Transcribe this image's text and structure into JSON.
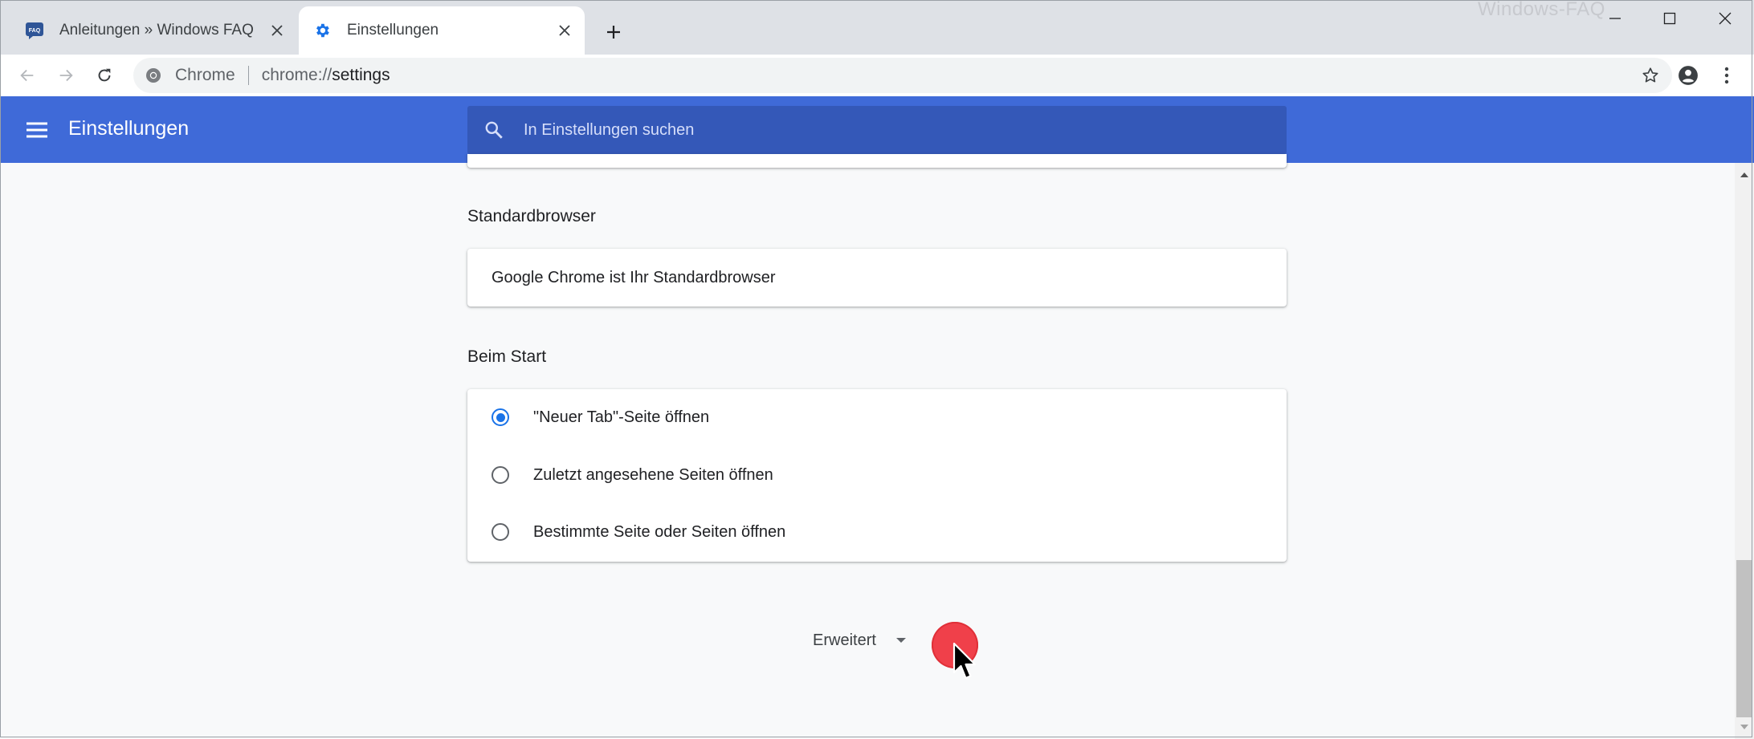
{
  "browser": {
    "tabs": [
      {
        "label": "Anleitungen » Windows FAQ",
        "favicon": "faq-favicon",
        "favicon_text": "FAQ",
        "active": false
      },
      {
        "label": "Einstellungen",
        "favicon": "settings-gear-icon",
        "active": true
      }
    ],
    "watermark": "Windows-FAQ",
    "omnibox": {
      "chip": "Chrome",
      "scheme": "chrome://",
      "path": "settings"
    }
  },
  "header": {
    "title": "Einstellungen",
    "search_placeholder": "In Einstellungen suchen"
  },
  "sections": {
    "default_browser": {
      "title": "Standardbrowser",
      "status": "Google Chrome ist Ihr Standardbrowser"
    },
    "on_startup": {
      "title": "Beim Start",
      "options": [
        {
          "label": "\"Neuer Tab\"-Seite öffnen",
          "checked": true
        },
        {
          "label": "Zuletzt angesehene Seiten öffnen",
          "checked": false
        },
        {
          "label": "Bestimmte Seite oder Seiten öffnen",
          "checked": false
        }
      ]
    },
    "advanced": {
      "label": "Erweitert"
    }
  },
  "colors": {
    "header_blue": "#3f6ad8",
    "search_blue": "#3458b8",
    "accent": "#1a73e8",
    "click_marker": "#f0404a"
  }
}
